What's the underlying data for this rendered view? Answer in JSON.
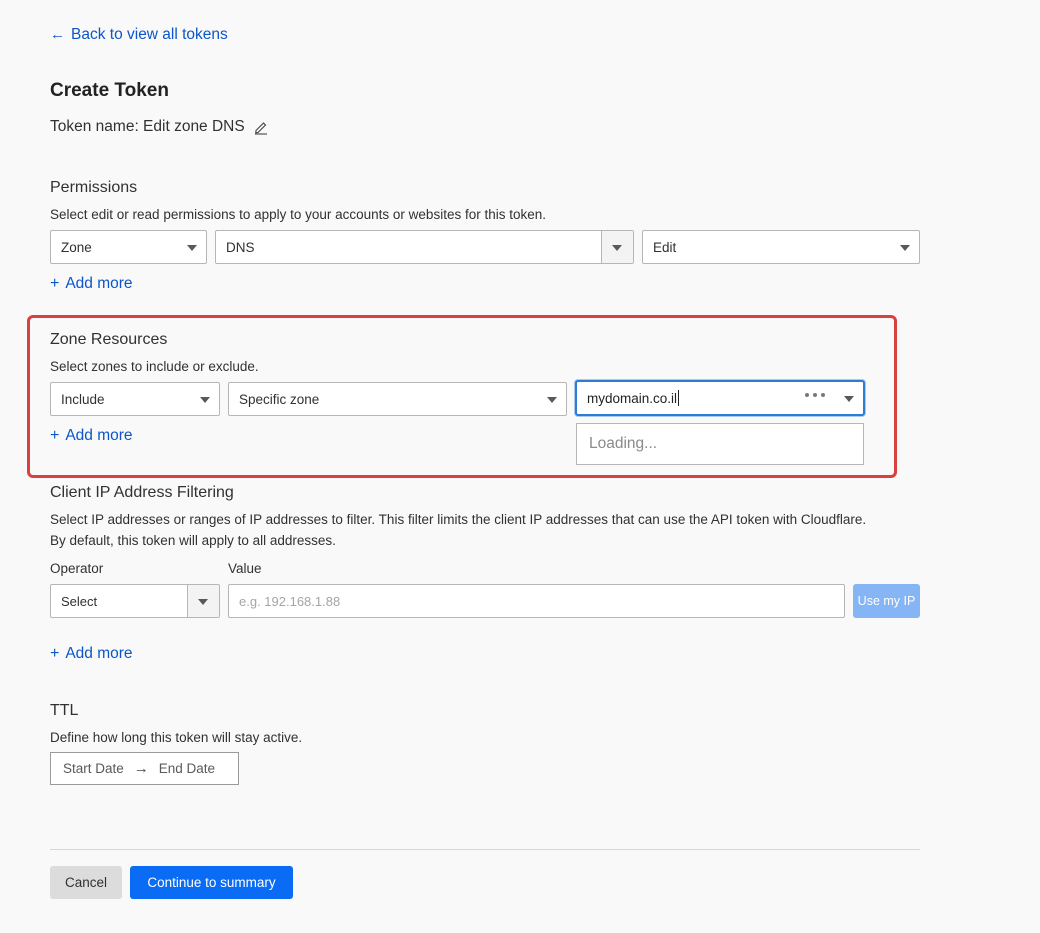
{
  "header": {
    "back_link": "Back to view all tokens",
    "title": "Create Token",
    "token_name": "Token name: Edit zone DNS"
  },
  "permissions": {
    "title": "Permissions",
    "description": "Select edit or read permissions to apply to your accounts or websites for this token.",
    "scope": "Zone",
    "resource": "DNS",
    "access": "Edit",
    "add_more": "Add more"
  },
  "zone_resources": {
    "title": "Zone Resources",
    "description": "Select zones to include or exclude.",
    "mode": "Include",
    "target": "Specific zone",
    "zone_value": "mydomain.co.il",
    "dropdown_status": "Loading...",
    "add_more": "Add more"
  },
  "ip_filtering": {
    "title": "Client IP Address Filtering",
    "description": "Select IP addresses or ranges of IP addresses to filter. This filter limits the client IP addresses that can use the API token with Cloudflare. By default, this token will apply to all addresses.",
    "operator_label": "Operator",
    "operator_value": "Select",
    "value_label": "Value",
    "value_placeholder": "e.g. 192.168.1.88",
    "use_ip_button": "Use my IP",
    "add_more": "Add more"
  },
  "ttl": {
    "title": "TTL",
    "description": "Define how long this token will stay active.",
    "start_date": "Start Date",
    "end_date": "End Date"
  },
  "footer": {
    "cancel": "Cancel",
    "continue": "Continue to summary"
  },
  "colors": {
    "link": "#0b56c9",
    "primary_button": "#0a6cf5",
    "highlight_border": "#d9403e",
    "focus_border": "#2c7cd1"
  }
}
